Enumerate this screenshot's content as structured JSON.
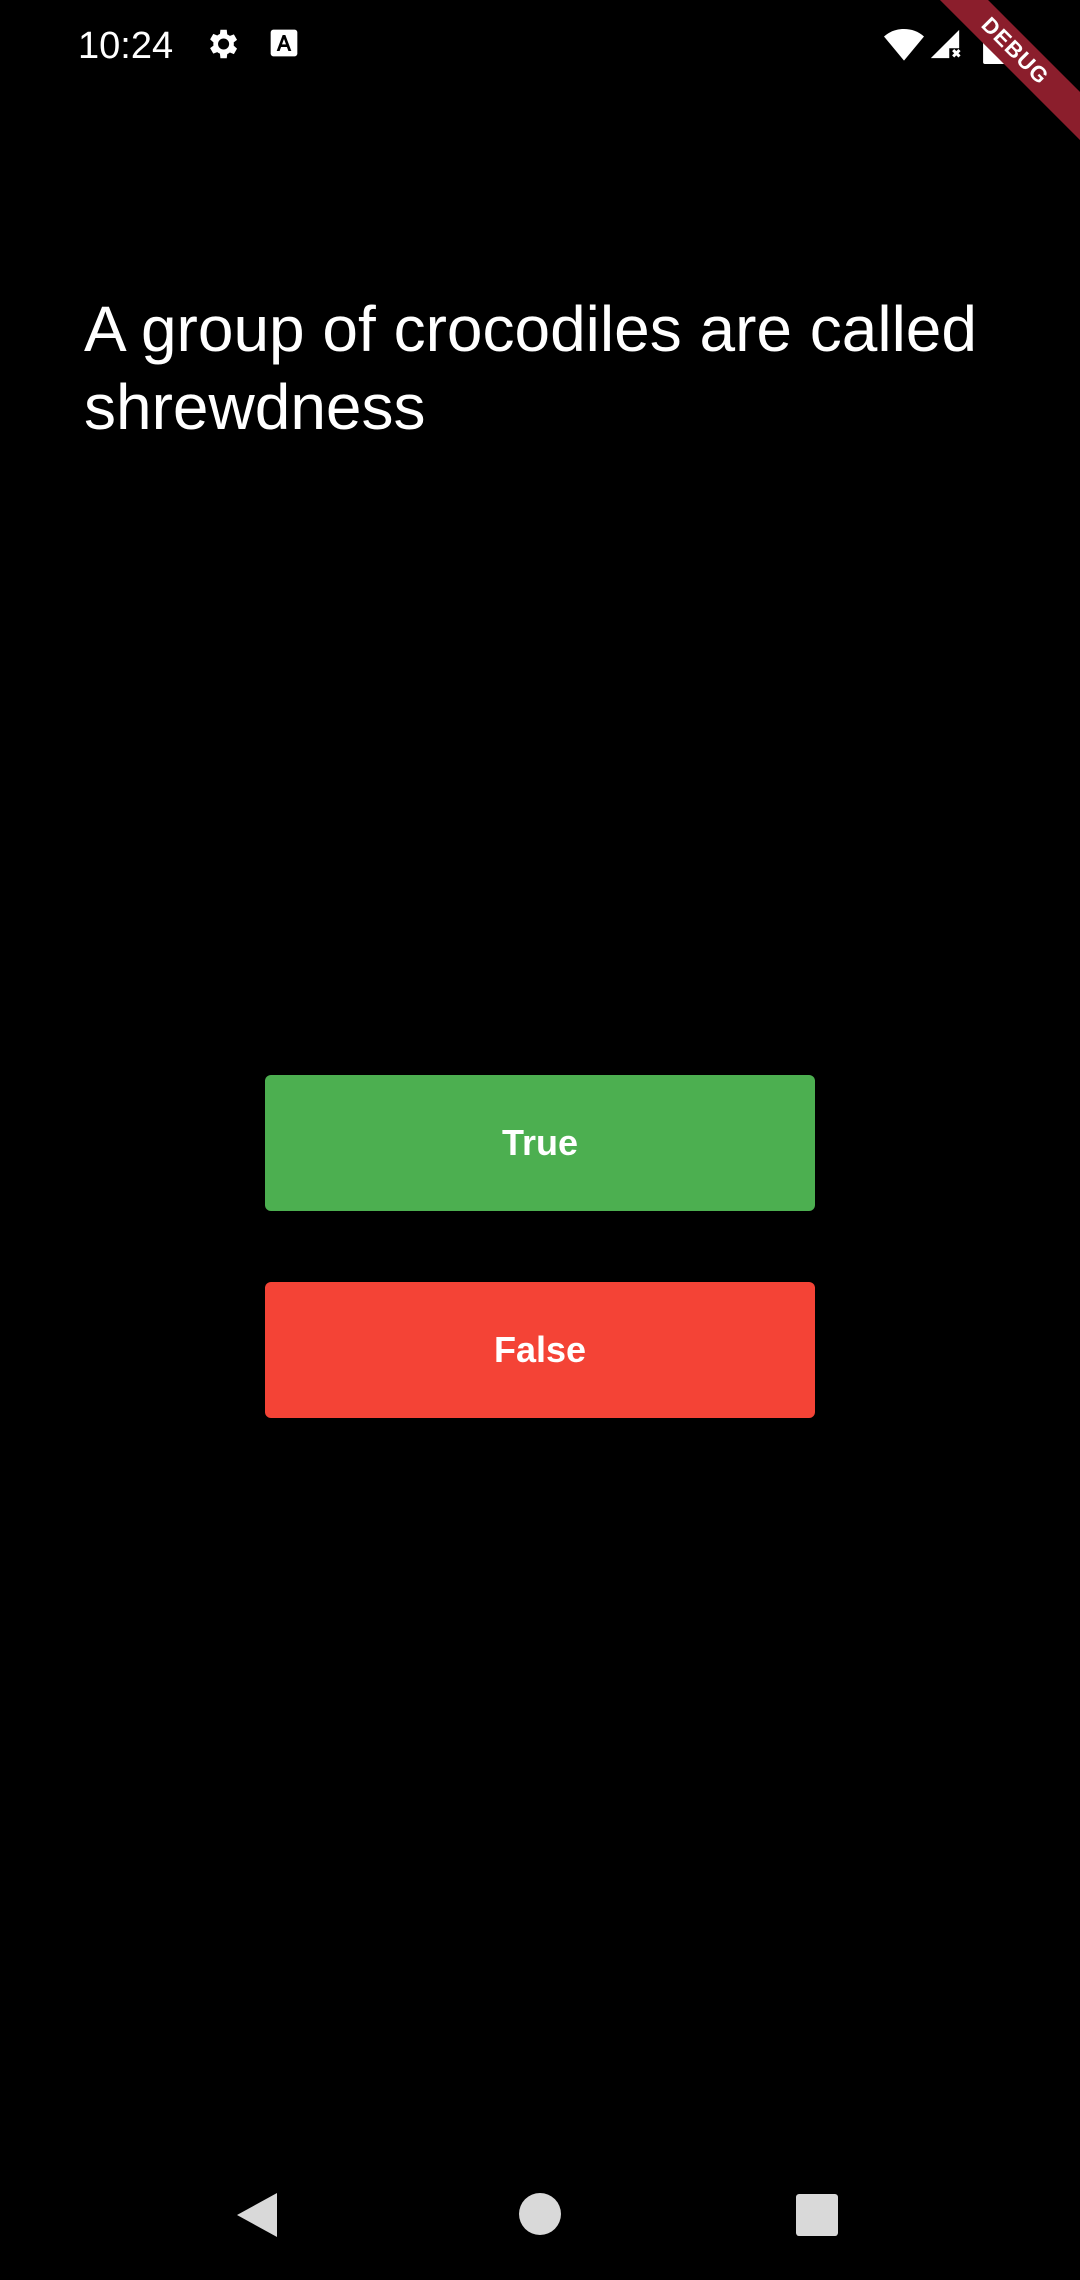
{
  "status_bar": {
    "time": "10:24",
    "icons": [
      "gear-icon",
      "a-icon",
      "wifi-icon",
      "signal-icon",
      "battery-icon"
    ]
  },
  "debug_banner": {
    "label": "DEBUG",
    "color": "#8b1e2c"
  },
  "question": {
    "text": "A group of crocodiles are called shrewdness"
  },
  "answers": {
    "true_label": "True",
    "true_color": "#4caf50",
    "false_label": "False",
    "false_color": "#f44336"
  },
  "navigation": {
    "icons": [
      "back-icon",
      "home-icon",
      "recents-icon"
    ]
  },
  "colors": {
    "background": "#000000",
    "text": "#ffffff"
  }
}
